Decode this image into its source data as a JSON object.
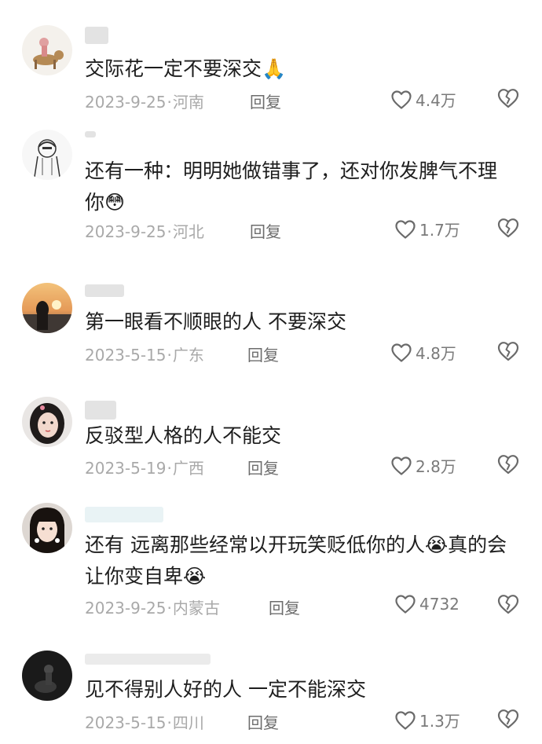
{
  "comments": [
    {
      "text": "交际花一定不要深交",
      "emoji": "🙏",
      "date": "2023-9-25",
      "location": "河南",
      "reply_label": "回复",
      "likes": "4.4万"
    },
    {
      "text": "还有一种：明明她做错事了，还对你发脾气不理你",
      "emoji": "😳",
      "date": "2023-9-25",
      "location": "河北",
      "reply_label": "回复",
      "likes": "1.7万"
    },
    {
      "text": "第一眼看不顺眼的人  不要深交",
      "date": "2023-5-15",
      "location": "广东",
      "reply_label": "回复",
      "likes": "4.8万"
    },
    {
      "text": "反驳型人格的人不能交",
      "date": "2023-5-19",
      "location": "广西",
      "reply_label": "回复",
      "likes": "2.8万"
    },
    {
      "text_a": "还有 远离那些经常以开玩笑贬低你的人",
      "text_b": "真的会让你变自卑",
      "emoji": "😭",
      "date": "2023-9-25",
      "location": "内蒙古",
      "reply_label": "回复",
      "likes": "4732"
    },
    {
      "text": "见不得别人好的人 一定不能深交",
      "date": "2023-5-15",
      "location": "四川",
      "reply_label": "回复",
      "likes": "1.3万"
    }
  ],
  "separator": "·",
  "icons": {
    "like": "heart-outline-icon",
    "dislike": "broken-heart-outline-icon"
  }
}
